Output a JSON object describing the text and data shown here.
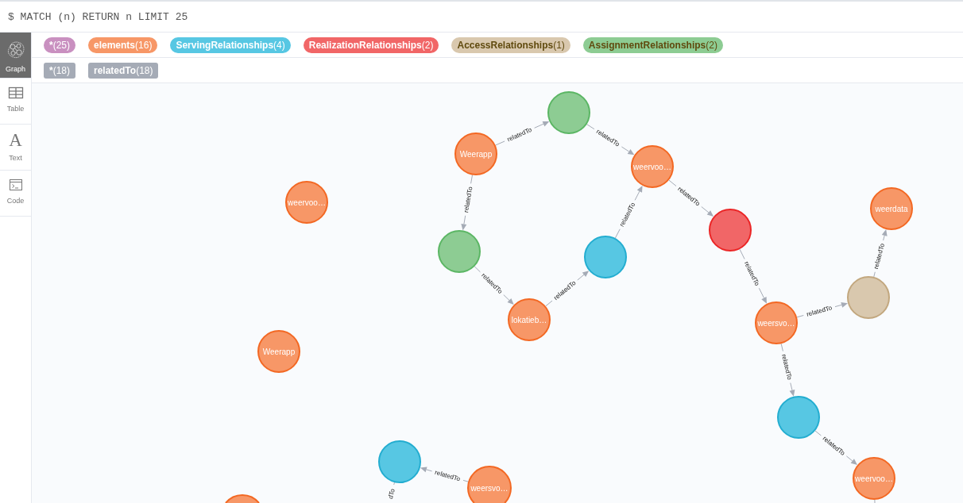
{
  "query": {
    "text": "$ MATCH (n) RETURN n LIMIT 25"
  },
  "sidebar": {
    "items": [
      {
        "kind": "graph",
        "label": "Graph",
        "selected": true
      },
      {
        "kind": "table",
        "label": "Table",
        "selected": false
      },
      {
        "kind": "letter",
        "glyph": "A",
        "label": "Text",
        "selected": false
      },
      {
        "kind": "terminal",
        "label": "Code",
        "selected": false
      }
    ]
  },
  "legend": {
    "node_labels": [
      {
        "name": "*",
        "count": "(25)",
        "color": "#c990c0"
      },
      {
        "name": "elements",
        "count": "(16)",
        "color": "#f79767"
      },
      {
        "name": "ServingRelationships",
        "count": "(4)",
        "color": "#57c7e3"
      },
      {
        "name": "RealizationRelationships",
        "count": "(2)",
        "color": "#f16667"
      },
      {
        "name": "AccessRelationships",
        "count": "(1)",
        "color": "#d9c8ae"
      },
      {
        "name": "AssignmentRelationships",
        "count": "(2)",
        "color": "#8dcc93"
      }
    ],
    "relationship_types": [
      {
        "name": "*",
        "count": "(18)"
      },
      {
        "name": "relatedTo",
        "count": "(18)"
      }
    ]
  },
  "graph": {
    "nodes": [
      {
        "color": "#8dcc93"
      },
      {
        "caption": "Weerapp",
        "color": "#f79767"
      },
      {
        "caption": "weervoo…",
        "color": "#f79767"
      },
      {
        "caption": "weervoo…",
        "color": "#f79767"
      },
      {
        "caption": "weerdata",
        "color": "#f79767"
      },
      {
        "color": "#f16667"
      },
      {
        "color": "#8dcc93"
      },
      {
        "color": "#57c7e3"
      },
      {
        "color": "#d9c8ae"
      },
      {
        "caption": "lokatieb…",
        "color": "#f79767"
      },
      {
        "caption": "weersvo…",
        "color": "#f79767"
      },
      {
        "caption": "Weerapp",
        "color": "#f79767"
      },
      {
        "color": "#57c7e3"
      },
      {
        "color": "#57c7e3"
      },
      {
        "caption": "weervoo…",
        "color": "#f79767"
      },
      {
        "caption": "weersvo…",
        "color": "#f79767"
      },
      {
        "color": "#f79767"
      }
    ],
    "relationships": [
      {
        "kind": "arrow",
        "label": "relatedTo"
      },
      {
        "kind": "arrow",
        "label": "relatedTo"
      },
      {
        "kind": "arrow",
        "label": "relatedTo"
      },
      {
        "kind": "arrow",
        "label": "relatedTo"
      },
      {
        "kind": "arrow",
        "label": "relatedTo"
      },
      {
        "kind": "arrow",
        "label": "relatedTo"
      },
      {
        "kind": "arrow",
        "label": "relatedTo"
      },
      {
        "kind": "arrow",
        "label": "relatedTo"
      },
      {
        "kind": "arrow",
        "label": "relatedTo"
      },
      {
        "kind": "arrow",
        "label": "relatedTo"
      },
      {
        "kind": "arrow",
        "label": "relatedTo"
      },
      {
        "kind": "arrow",
        "label": "relatedTo"
      },
      {
        "kind": "arrow",
        "label": "relatedTo"
      },
      {
        "kind": "stub",
        "label": "dTo"
      },
      {
        "kind": "stub"
      }
    ]
  }
}
